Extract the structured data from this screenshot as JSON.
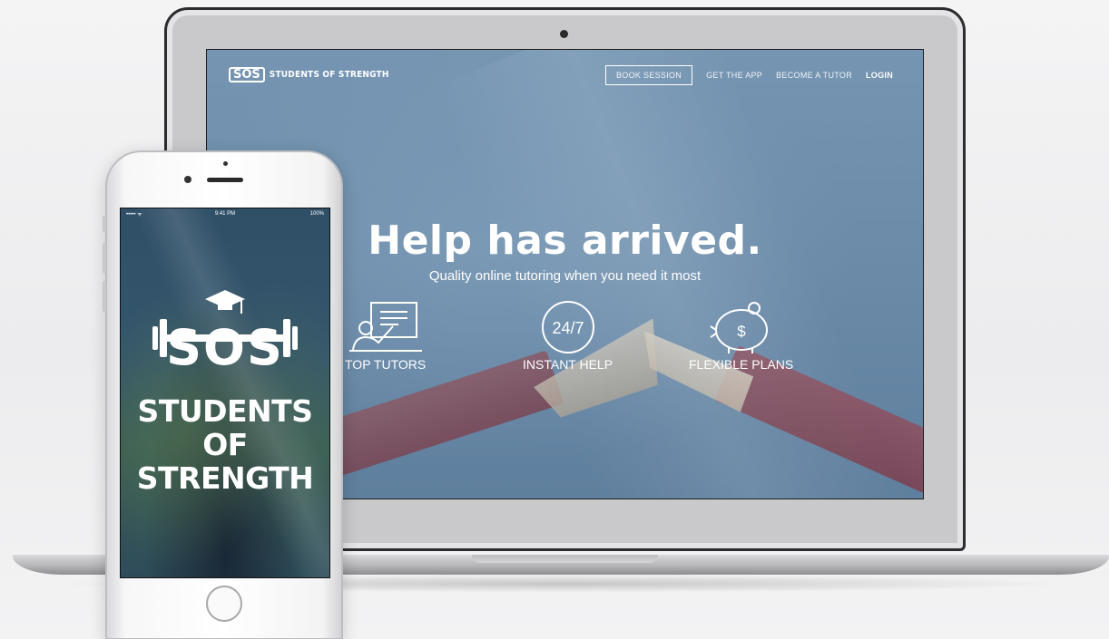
{
  "laptop": {
    "nav": {
      "brand_logo": "SOS",
      "brand_name": "STUDENTS OF STRENGTH",
      "links": [
        {
          "label": "BOOK SESSION",
          "style": "outlined"
        },
        {
          "label": "GET THE APP"
        },
        {
          "label": "BECOME A TUTOR"
        },
        {
          "label": "LOGIN",
          "style": "bold"
        }
      ]
    },
    "hero": {
      "title": "Help has arrived.",
      "subtitle": "Quality online tutoring when you need it most"
    },
    "features": [
      {
        "label": "TOP TUTORS",
        "icon": "tutor-whiteboard-icon"
      },
      {
        "label": "INSTANT HELP",
        "icon": "clock-24-7-icon",
        "icon_text": "24/7"
      },
      {
        "label": "FLEXIBLE PLANS",
        "icon": "piggy-bank-icon",
        "icon_text": "$"
      }
    ]
  },
  "phone": {
    "status": {
      "carrier": "••••• ᯤ",
      "time": "9:41 PM",
      "battery": "100%"
    },
    "logo_text": "SOS",
    "title_lines": [
      "STUDENTS",
      "OF",
      "STRENGTH"
    ]
  },
  "colors": {
    "screen_overlay": "#6a8cab",
    "phone_overlay": "#2f4f67",
    "text": "#ffffff"
  }
}
